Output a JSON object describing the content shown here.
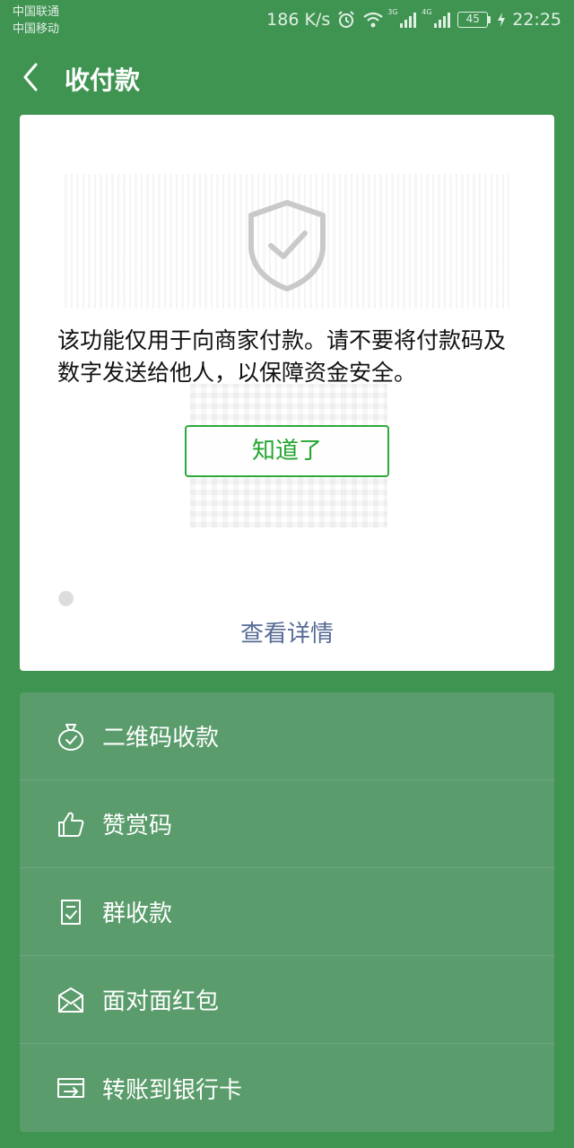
{
  "status_bar": {
    "carrier_1": "中国联通",
    "carrier_2": "中国移动",
    "speed": "186 K/s",
    "sig1_tag": "3G",
    "sig2_tag": "4G",
    "battery": "45",
    "time": "22:25"
  },
  "header": {
    "title": "收付款"
  },
  "card": {
    "notice": "该功能仅用于向商家付款。请不要将付款码及数字发送给他人，以保障资金安全。",
    "confirm_button": "知道了",
    "details_link": "查看详情"
  },
  "menu": {
    "items": [
      {
        "label": "二维码收款",
        "icon": "money-bag-icon"
      },
      {
        "label": "赞赏码",
        "icon": "thumbs-up-icon"
      },
      {
        "label": "群收款",
        "icon": "clipboard-check-icon"
      },
      {
        "label": "面对面红包",
        "icon": "envelope-icon"
      },
      {
        "label": "转账到银行卡",
        "icon": "bank-card-transfer-icon"
      }
    ]
  },
  "colors": {
    "background": "#3f9452",
    "accent_green": "#22a52f",
    "link_blue": "#576b95"
  }
}
